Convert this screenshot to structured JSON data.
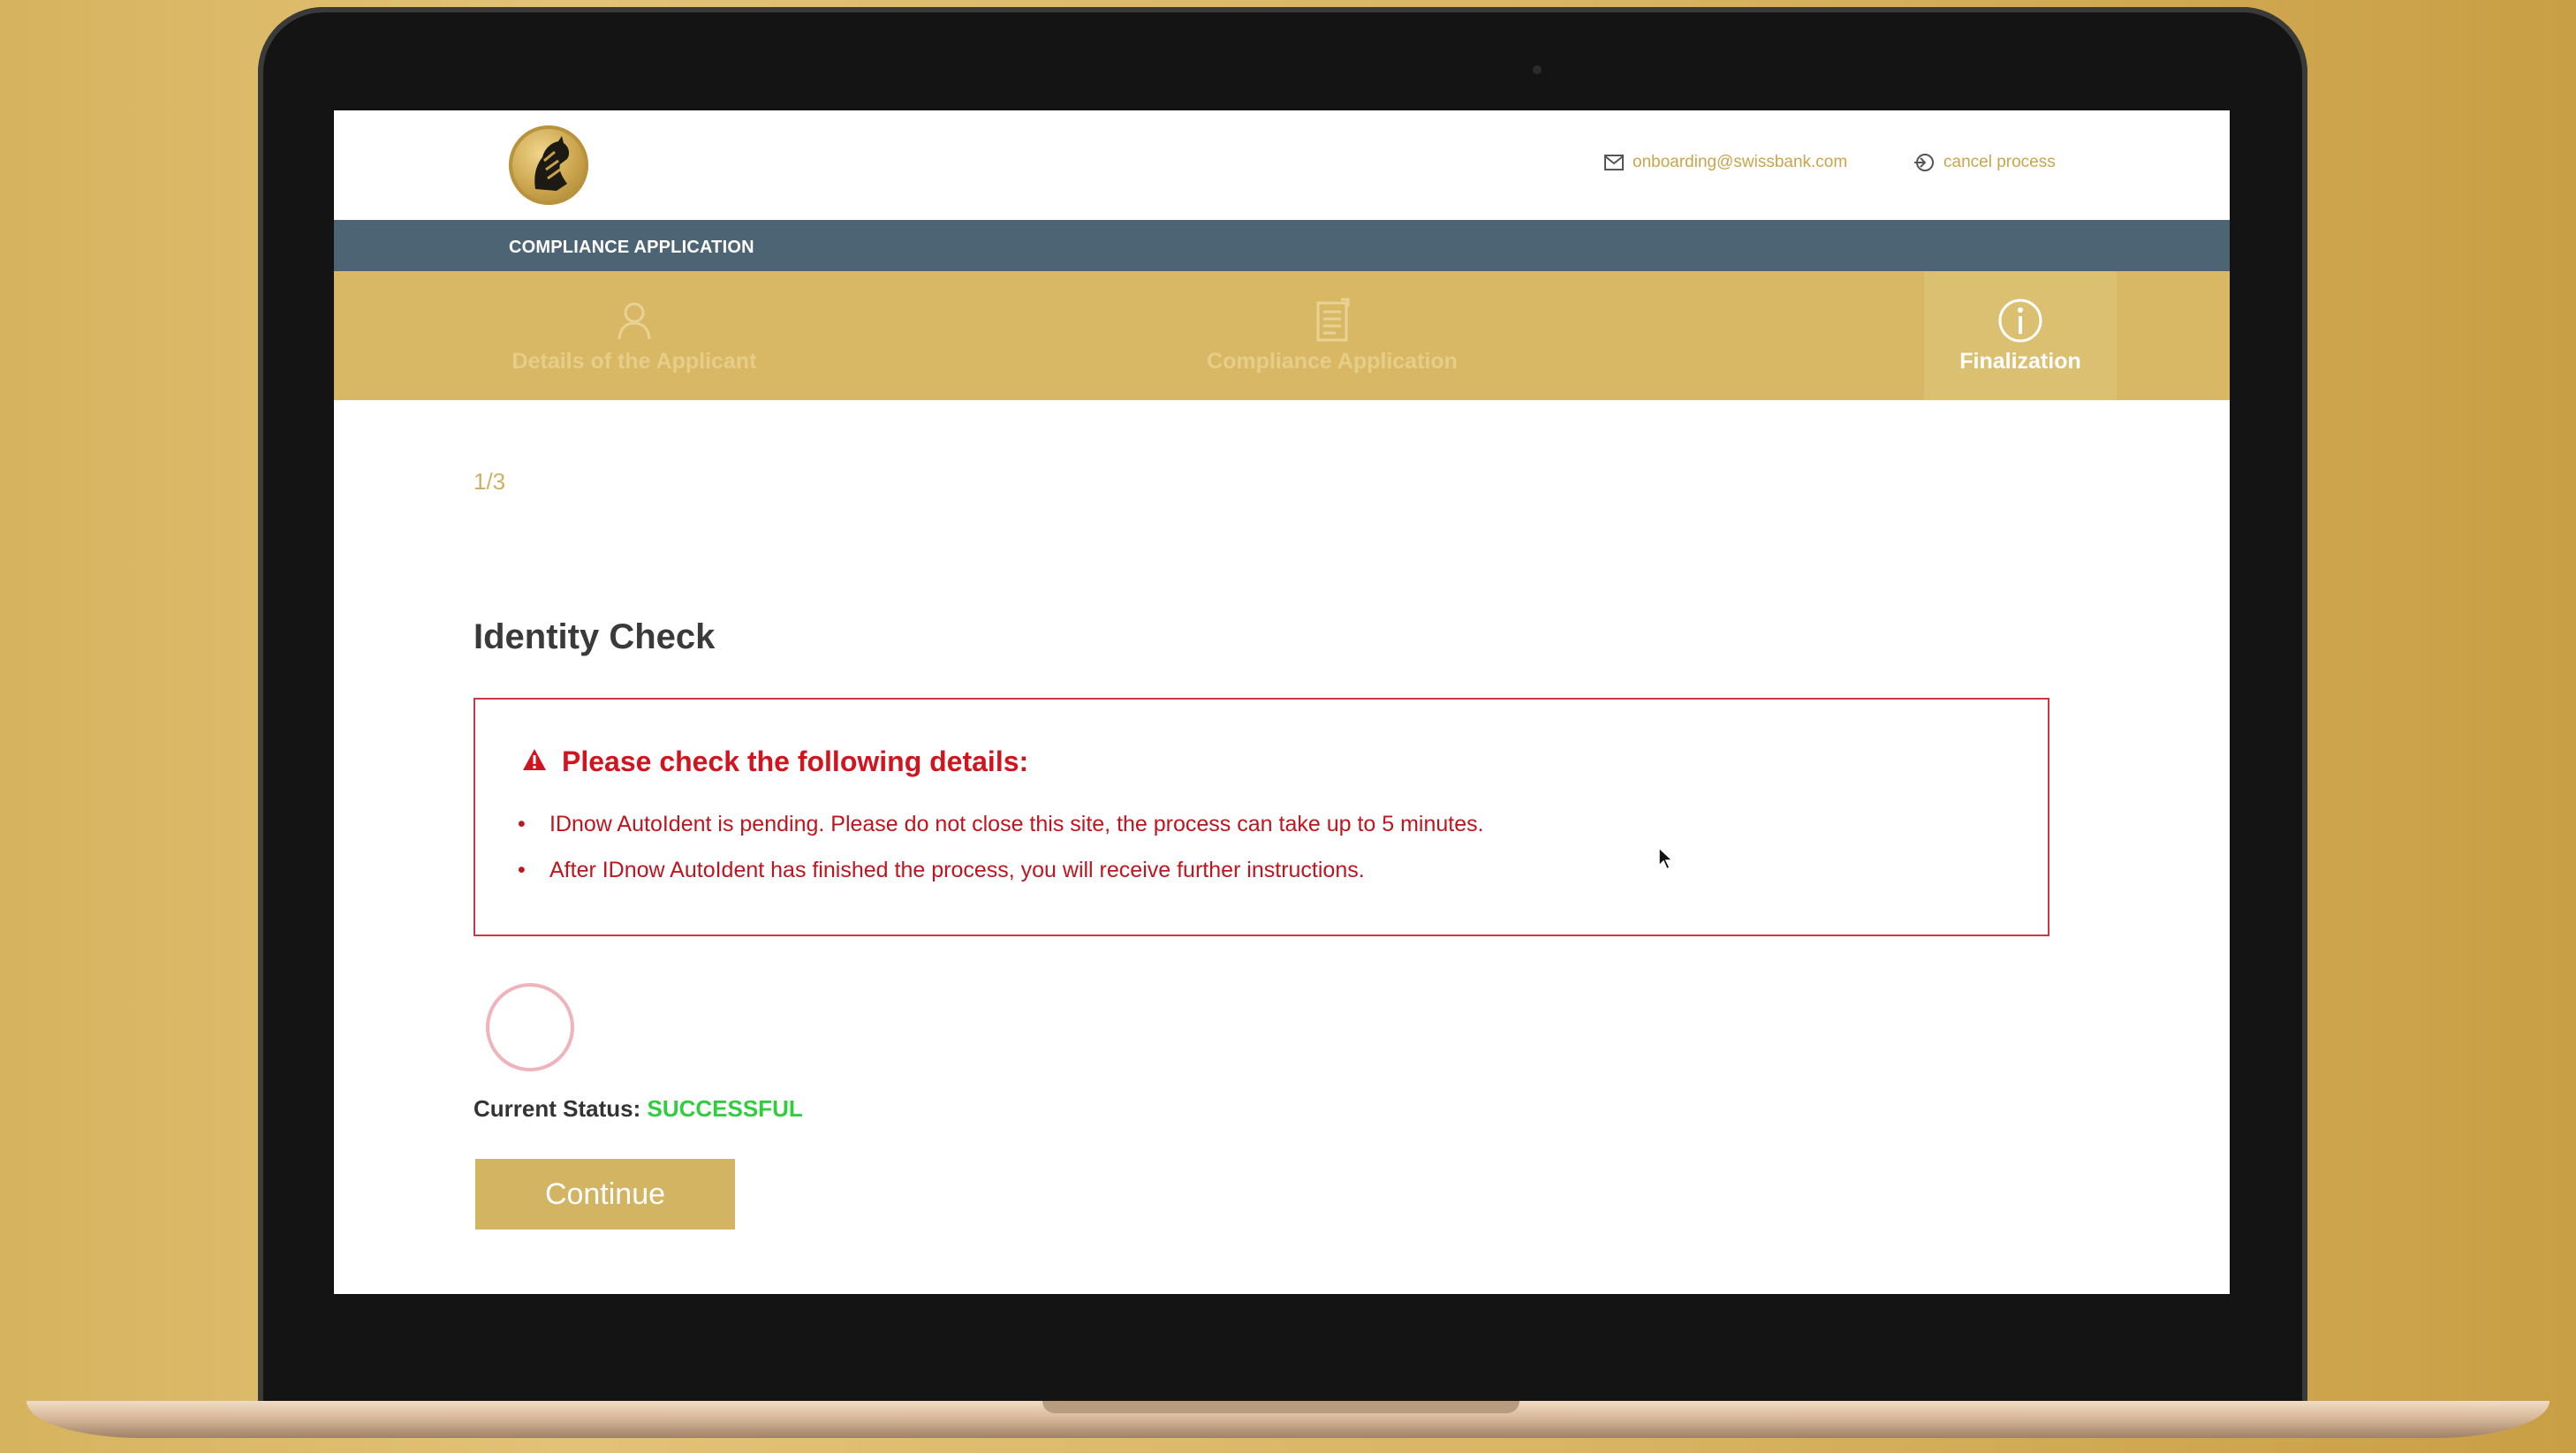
{
  "header": {
    "email": "onboarding@swissbank.com",
    "cancel_label": "cancel process"
  },
  "app_title": "COMPLIANCE APPLICATION",
  "steps": [
    {
      "label": "Details of the Applicant",
      "icon": "person-icon",
      "active": false
    },
    {
      "label": "Compliance Application",
      "icon": "document-icon",
      "active": false
    },
    {
      "label": "Finalization",
      "icon": "info-icon",
      "active": true
    }
  ],
  "main": {
    "counter": "1/3",
    "title": "Identity Check",
    "alert": {
      "title": "Please check the following details:",
      "items": [
        "IDnow AutoIdent is pending. Please do not close this site, the process can take up to 5 minutes.",
        "After IDnow AutoIdent has finished the process, you will receive further instructions."
      ]
    },
    "status_label": "Current Status:",
    "status_value": "SUCCESSFUL",
    "continue_label": "Continue"
  },
  "colors": {
    "gold": "#d9b865",
    "nav_bar": "#4d6474",
    "alert_red": "#d2141e",
    "success_green": "#2fce3f"
  }
}
